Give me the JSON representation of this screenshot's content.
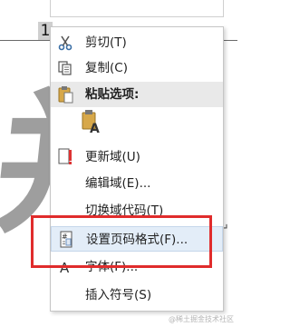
{
  "document": {
    "page_number": "1",
    "watermark_char": "并",
    "corner_text": "@稀土掘金技术社区",
    "cursor_mark": "↵"
  },
  "context_menu": {
    "items": [
      {
        "label": "剪切(T)",
        "icon": "scissors-icon"
      },
      {
        "label": "复制(C)",
        "icon": "copy-icon"
      },
      {
        "label": "粘贴选项:",
        "icon": "paste-icon"
      },
      {
        "label": "更新域(U)",
        "icon": "update-field-icon"
      },
      {
        "label": "编辑域(E)...",
        "icon": ""
      },
      {
        "label": "切换域代码(T)",
        "icon": ""
      },
      {
        "label": "设置页码格式(F)...",
        "icon": "page-number-format-icon"
      },
      {
        "label": "字体(F)...",
        "icon": "font-icon"
      },
      {
        "label": "插入符号(S)",
        "icon": ""
      }
    ],
    "paste_option_icon": "paste-keep-text-icon"
  },
  "annotation": {
    "color": "#e02c2c"
  }
}
